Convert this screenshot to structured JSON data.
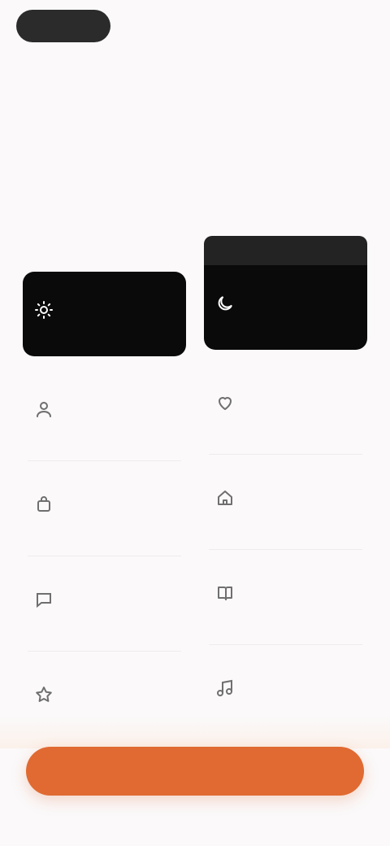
{
  "header": {
    "logo_text": "",
    "skip_label": ""
  },
  "title": "",
  "subtitle": "",
  "columns": [
    {
      "label": "",
      "active": false,
      "tiles": [
        {
          "label": "",
          "icon": "sun-icon",
          "selected": true
        },
        {
          "label": "",
          "icon": "user-icon",
          "selected": false
        },
        {
          "label": "",
          "icon": "bag-icon",
          "selected": false
        },
        {
          "label": "",
          "icon": "chat-icon",
          "selected": false
        },
        {
          "label": "",
          "icon": "star-icon",
          "selected": false
        }
      ]
    },
    {
      "label": "",
      "active": true,
      "tiles": [
        {
          "label": "",
          "icon": "moon-icon",
          "selected": true
        },
        {
          "label": "",
          "icon": "heart-icon",
          "selected": false
        },
        {
          "label": "",
          "icon": "home-icon",
          "selected": false
        },
        {
          "label": "",
          "icon": "book-icon",
          "selected": false
        },
        {
          "label": "",
          "icon": "music-icon",
          "selected": false
        }
      ]
    }
  ],
  "cta_label": "",
  "colors": {
    "accent": "#e06a32",
    "selected_tile": "#0a0a0a",
    "background": "#fbf9fa"
  }
}
